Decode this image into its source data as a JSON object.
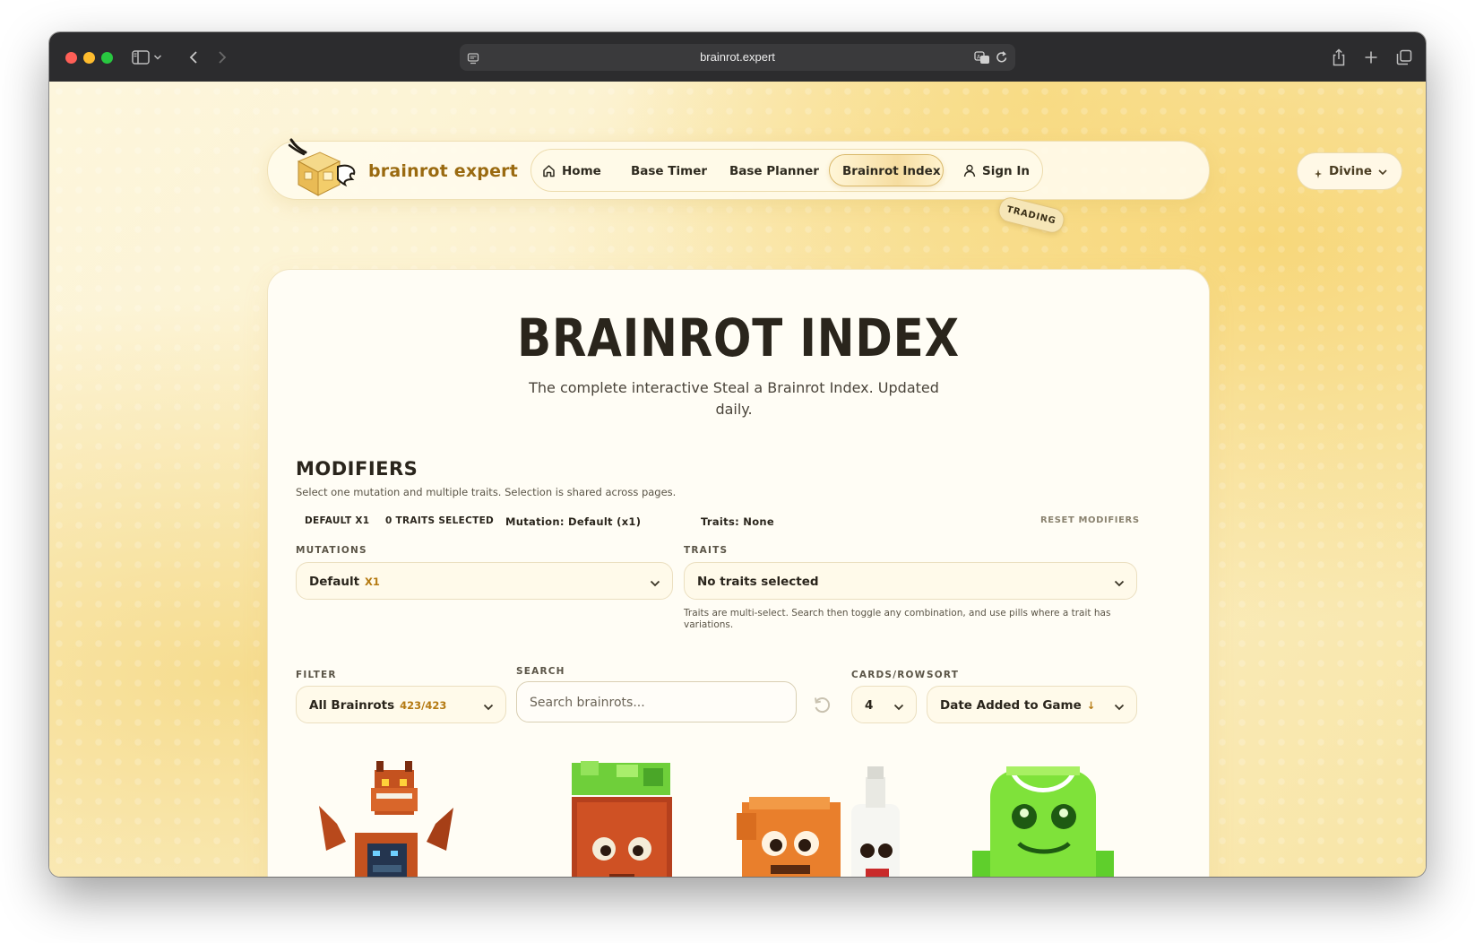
{
  "browser": {
    "url": "brainrot.expert"
  },
  "nav": {
    "brand": "brainrot expert",
    "items": [
      {
        "label": "Home",
        "icon": "home-icon"
      },
      {
        "label": "Base Timer"
      },
      {
        "label": "Base Planner"
      },
      {
        "label": "Brainrot Index",
        "active": true
      },
      {
        "label": "Sign In",
        "icon": "user-icon"
      }
    ],
    "trading_badge": "TRADING",
    "theme_select": "Divine"
  },
  "page": {
    "title": "BRAINROT INDEX",
    "subtitle": "The complete interactive Steal a Brainrot Index. Updated daily."
  },
  "modifiers": {
    "heading": "MODIFIERS",
    "description": "Select one mutation and multiple traits. Selection is shared across pages.",
    "summary_tags": [
      "DEFAULT X1",
      "0 TRAITS SELECTED",
      "Mutation: Default (x1)",
      "Traits: None"
    ],
    "reset_label": "RESET MODIFIERS",
    "mutations_label": "MUTATIONS",
    "mutation_value": "Default",
    "mutation_multiplier": "X1",
    "traits_label": "TRAITS",
    "traits_value": "No traits selected",
    "traits_help": "Traits are multi-select. Search then toggle any combination, and use pills where a trait has variations."
  },
  "controls": {
    "filter_label": "FILTER",
    "filter_value": "All Brainrots",
    "filter_count": "423/423",
    "search_label": "SEARCH",
    "search_placeholder": "Search brainrots...",
    "cards_label": "CARDS/ROW",
    "cards_value": "4",
    "sort_label": "SORT",
    "sort_value": "Date Added to Game",
    "sort_direction": "↓"
  },
  "cards": [
    {
      "icon": "dragon-brainrot-icon"
    },
    {
      "icon": "money-box-brainrot-icon"
    },
    {
      "icon": "duo-brainrot-icon"
    },
    {
      "icon": "green-ball-brainrot-icon"
    }
  ],
  "colors": {
    "accent": "#b57a12",
    "brand_text": "#9a6a10",
    "page_background": "#fbefc6"
  }
}
